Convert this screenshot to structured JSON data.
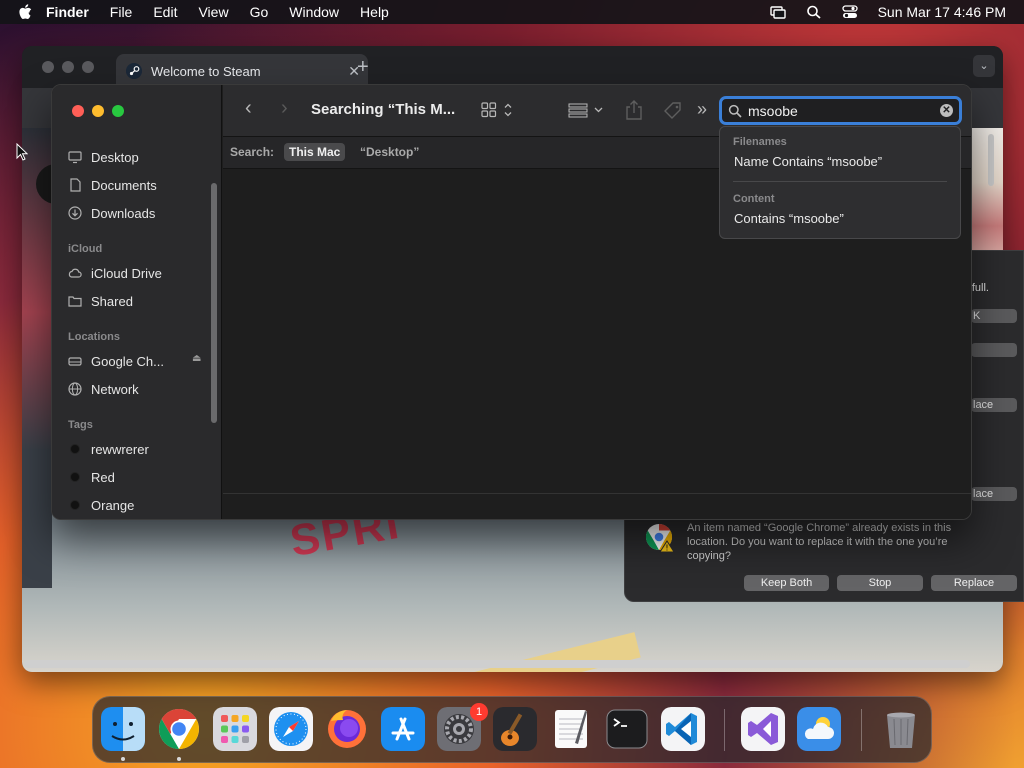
{
  "menubar": {
    "app": "Finder",
    "items": [
      "File",
      "Edit",
      "View",
      "Go",
      "Window",
      "Help"
    ],
    "datetime": "Sun Mar 17  4:46 PM"
  },
  "chrome": {
    "tab_title": "Welcome to Steam",
    "art_text": "SPRI"
  },
  "finder": {
    "title": "Searching “This M...",
    "sidebar": {
      "favorites": [
        {
          "label": "Desktop",
          "icon": "desktop-icon"
        },
        {
          "label": "Documents",
          "icon": "document-icon"
        },
        {
          "label": "Downloads",
          "icon": "download-icon"
        }
      ],
      "icloud_header": "iCloud",
      "icloud": [
        {
          "label": "iCloud Drive",
          "icon": "cloud-icon"
        },
        {
          "label": "Shared",
          "icon": "shared-folder-icon"
        }
      ],
      "locations_header": "Locations",
      "locations": [
        {
          "label": "Google Ch...",
          "icon": "drive-icon"
        },
        {
          "label": "Network",
          "icon": "globe-icon"
        }
      ],
      "tags_header": "Tags",
      "tags": [
        "rewwrerer",
        "Red",
        "Orange"
      ]
    },
    "search": {
      "label": "Search:",
      "scope_selected": "This Mac",
      "scope_other": "“Desktop”",
      "query": "msoobe",
      "suggestions": {
        "filenames_header": "Filenames",
        "filenames_item": "Name Contains “msoobe”",
        "content_header": "Content",
        "content_item": "Contains “msoobe”"
      }
    }
  },
  "dialog": {
    "fragment_text": "full.",
    "fragment_btn1": "K",
    "fragment_btn2": "lace",
    "fragment_btn3": "lace",
    "message": "An item named “Google Chrome” already exists in this location. Do you want to replace it with the one you’re copying?",
    "buttons": {
      "keep_both": "Keep Both",
      "stop": "Stop",
      "replace": "Replace"
    }
  },
  "dock": {
    "apps": [
      "finder",
      "chrome",
      "launchpad",
      "safari",
      "firefox",
      "app-store",
      "system-settings",
      "garageband",
      "textedit",
      "terminal",
      "vscode",
      "visual-studio",
      "weather",
      "trash"
    ],
    "settings_badge": "1"
  },
  "colors": {
    "accent": "#3a7fd8",
    "red_light": "#ff5f57",
    "yellow_light": "#febc2e",
    "green_light": "#28c840"
  }
}
